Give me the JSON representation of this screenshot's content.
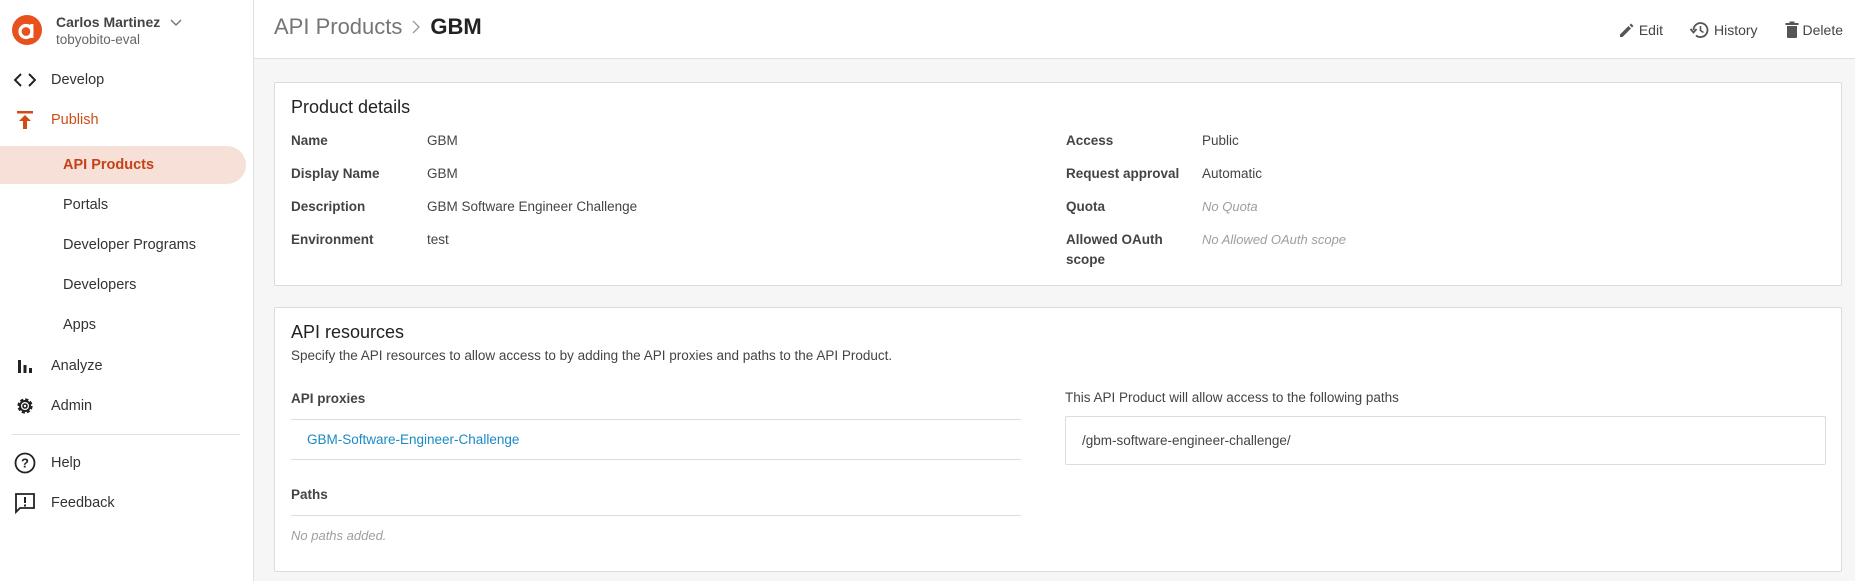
{
  "account": {
    "name": "Carlos Martinez",
    "org": "tobyobito-eval"
  },
  "sidebar": {
    "items": [
      {
        "label": "Develop",
        "icon": "code-icon"
      },
      {
        "label": "Publish",
        "icon": "publish-icon"
      },
      {
        "label": "Analyze",
        "icon": "bar-chart-icon"
      },
      {
        "label": "Admin",
        "icon": "gear-icon"
      },
      {
        "label": "Help",
        "icon": "help-circle-icon"
      },
      {
        "label": "Feedback",
        "icon": "feedback-icon"
      }
    ],
    "publish_subitems": [
      {
        "label": "API Products",
        "selected": true
      },
      {
        "label": "Portals"
      },
      {
        "label": "Developer Programs"
      },
      {
        "label": "Developers"
      },
      {
        "label": "Apps"
      }
    ]
  },
  "header": {
    "breadcrumb_parent": "API Products",
    "title": "GBM",
    "actions": {
      "edit": "Edit",
      "history": "History",
      "delete": "Delete"
    }
  },
  "product_details": {
    "title": "Product details",
    "left": [
      {
        "label": "Name",
        "value": "GBM"
      },
      {
        "label": "Display Name",
        "value": "GBM"
      },
      {
        "label": "Description",
        "value": "GBM Software Engineer Challenge"
      },
      {
        "label": "Environment",
        "value": "test"
      }
    ],
    "right": [
      {
        "label": "Access",
        "value": "Public"
      },
      {
        "label": "Request approval",
        "value": "Automatic"
      },
      {
        "label": "Quota",
        "empty": "No Quota"
      },
      {
        "label": "Allowed OAuth scope",
        "empty": "No Allowed OAuth scope"
      }
    ]
  },
  "api_resources": {
    "title": "API resources",
    "subtitle": "Specify the API resources to allow access to by adding the API proxies and paths to the API Product.",
    "proxies_label": "API proxies",
    "proxies": [
      "GBM-Software-Engineer-Challenge"
    ],
    "paths_label": "Paths",
    "paths_empty": "No paths added.",
    "allowed_paths_label": "This API Product will allow access to the following paths",
    "allowed_paths": [
      "/gbm-software-engineer-challenge/"
    ]
  },
  "colors": {
    "accent": "#e8501c",
    "selected_bg": "#f7e0d7",
    "link": "#1a8ac4"
  }
}
